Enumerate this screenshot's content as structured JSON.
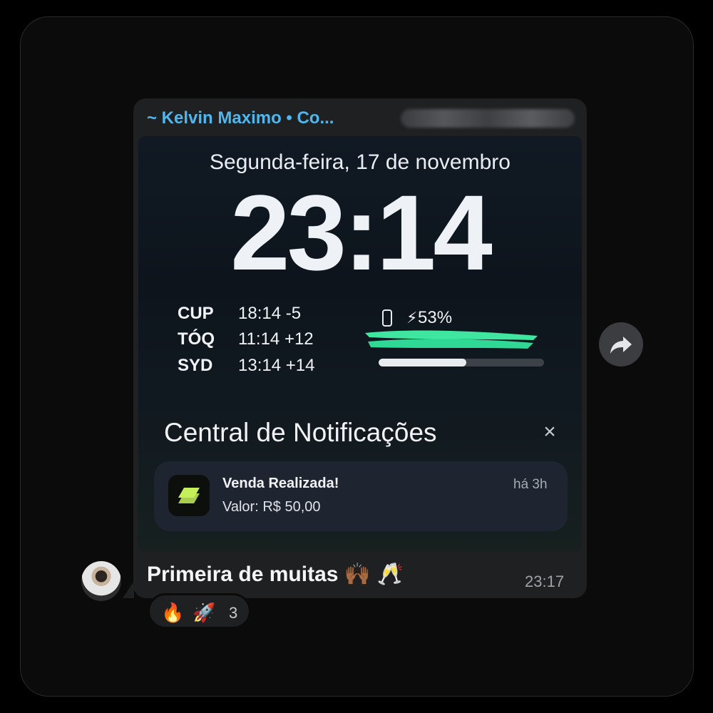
{
  "chat": {
    "sender_name": "~ Kelvin Maximo • Co...",
    "message_text": "Primeira de muitas 🙌🏾 🥂",
    "message_time": "23:17"
  },
  "lockscreen": {
    "date": "Segunda-feira, 17 de novembro",
    "time": "23:14",
    "world_clocks": [
      {
        "city": "CUP",
        "time": "18:14 -5"
      },
      {
        "city": "TÓQ",
        "time": "11:14 +12"
      },
      {
        "city": "SYD",
        "time": "13:14 +14"
      }
    ],
    "battery": {
      "label": "53%",
      "level": 0.53,
      "icon": "bolt-icon"
    },
    "notification_center": {
      "title": "Central de Notificações",
      "close_icon": "×"
    },
    "notification": {
      "title": "Venda Realizada!",
      "body": "Valor: R$ 50,00",
      "time": "há 3h"
    }
  },
  "reactions": {
    "emojis": [
      "🔥",
      "🚀"
    ],
    "count": "3"
  },
  "colors": {
    "sender": "#4fb7ee",
    "bubble": "#1f2022",
    "scribble": "#3ee6a0",
    "app_icon_accent": "#c6f05a"
  },
  "icons": {
    "forward": "forward-arrow-icon",
    "phone": "phone-icon"
  }
}
